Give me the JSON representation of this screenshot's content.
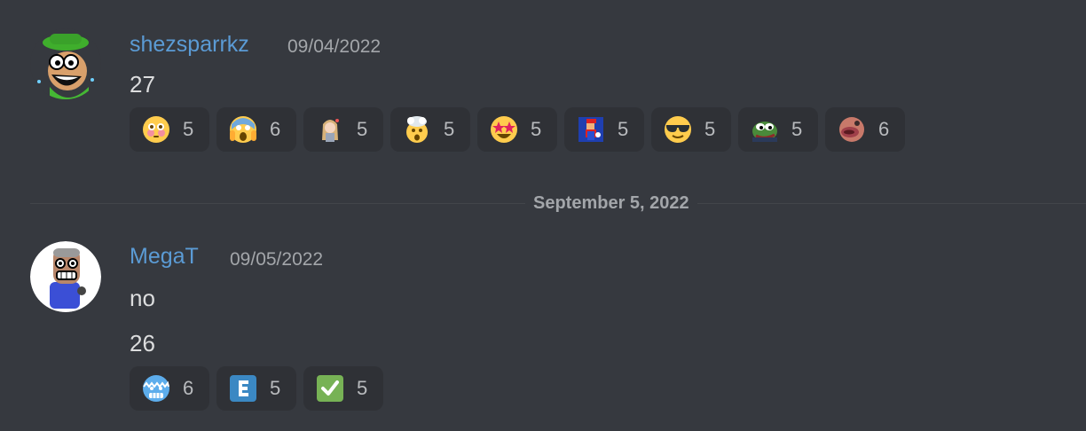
{
  "messages": [
    {
      "author": "shezsparrkz",
      "timestamp": "09/04/2022",
      "lines": [
        "27"
      ],
      "reactions": [
        {
          "emoji": "flushed-face",
          "count": "5"
        },
        {
          "emoji": "screaming-face",
          "count": "6"
        },
        {
          "emoji": "anime-girl-custom",
          "count": "5"
        },
        {
          "emoji": "exploding-head",
          "count": "5"
        },
        {
          "emoji": "star-struck",
          "count": "5"
        },
        {
          "emoji": "mario-custom",
          "count": "5"
        },
        {
          "emoji": "sunglasses-face",
          "count": "5"
        },
        {
          "emoji": "pepe-custom",
          "count": "5"
        },
        {
          "emoji": "lips-custom",
          "count": "6"
        }
      ]
    },
    {
      "author": "MegaT",
      "timestamp": "09/05/2022",
      "lines": [
        "no",
        "26"
      ],
      "reactions": [
        {
          "emoji": "cold-face",
          "count": "6"
        },
        {
          "emoji": "regional-indicator-e",
          "count": "5"
        },
        {
          "emoji": "check-mark-button",
          "count": "5"
        }
      ]
    }
  ],
  "divider": {
    "label": "September 5, 2022"
  },
  "colors": {
    "background": "#36393f",
    "username": "#5b9bd5",
    "reaction_bg": "#2f3136"
  }
}
